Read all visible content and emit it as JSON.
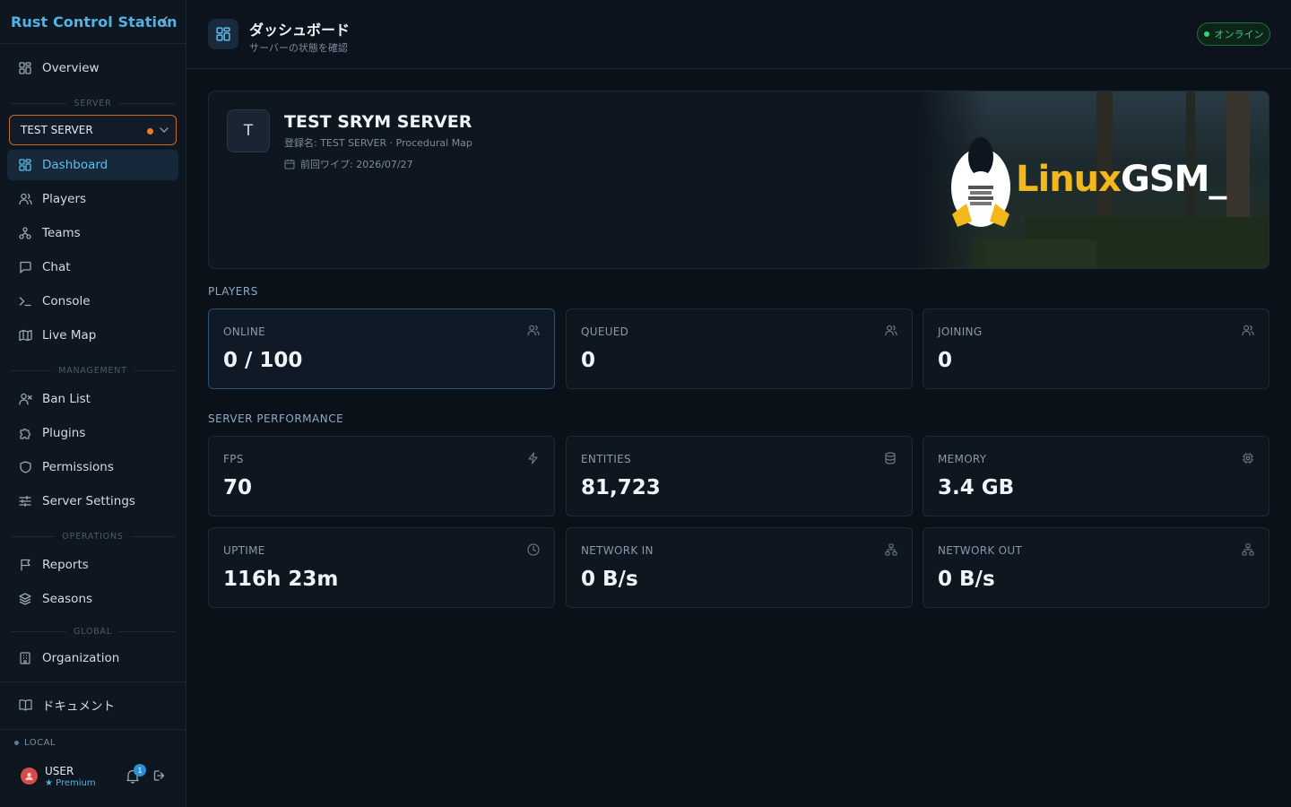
{
  "app": {
    "title": "Rust Control Station"
  },
  "sidebar": {
    "overview": "Overview",
    "sections": {
      "server": "SERVER",
      "management": "MANAGEMENT",
      "operations": "OPERATIONS",
      "global": "GLOBAL"
    },
    "server_select": {
      "value": "TEST SERVER",
      "status_color": "#f07b22"
    },
    "server_items": [
      {
        "label": "Dashboard",
        "icon": "dashboard-icon",
        "active": true
      },
      {
        "label": "Players",
        "icon": "users-icon"
      },
      {
        "label": "Teams",
        "icon": "teams-icon"
      },
      {
        "label": "Chat",
        "icon": "chat-icon"
      },
      {
        "label": "Console",
        "icon": "terminal-icon"
      },
      {
        "label": "Live Map",
        "icon": "map-icon"
      }
    ],
    "management_items": [
      {
        "label": "Ban List",
        "icon": "user-x-icon"
      },
      {
        "label": "Plugins",
        "icon": "puzzle-icon"
      },
      {
        "label": "Permissions",
        "icon": "shield-icon"
      },
      {
        "label": "Server Settings",
        "icon": "sliders-icon"
      }
    ],
    "operations_items": [
      {
        "label": "Reports",
        "icon": "flag-icon"
      },
      {
        "label": "Seasons",
        "icon": "layers-icon"
      }
    ],
    "global_items": [
      {
        "label": "Organization",
        "icon": "building-icon"
      }
    ],
    "docs": "ドキュメント",
    "env": "LOCAL",
    "user": {
      "name": "USER",
      "tier": "★ Premium",
      "notifications": "1"
    }
  },
  "header": {
    "title": "ダッシュボード",
    "subtitle": "サーバーの状態を確認",
    "status": "オンライン",
    "status_color": "#34d27a"
  },
  "server": {
    "initial": "T",
    "name": "TEST SRYM SERVER",
    "registered": "登録名: TEST SERVER · Procedural Map",
    "last_wipe": "前回ワイプ: 2026/07/27",
    "banner_left": "Linux",
    "banner_right": "GSM_"
  },
  "players": {
    "title": "PLAYERS",
    "stats": [
      {
        "label": "ONLINE",
        "value": "0 / 100",
        "icon": "users-icon"
      },
      {
        "label": "QUEUED",
        "value": "0",
        "icon": "users-icon"
      },
      {
        "label": "JOINING",
        "value": "0",
        "icon": "users-icon"
      }
    ]
  },
  "performance": {
    "title": "SERVER PERFORMANCE",
    "stats": [
      {
        "label": "FPS",
        "value": "70",
        "icon": "zap-icon"
      },
      {
        "label": "ENTITIES",
        "value": "81,723",
        "icon": "database-icon"
      },
      {
        "label": "MEMORY",
        "value": "3.4 GB",
        "icon": "cpu-icon"
      },
      {
        "label": "UPTIME",
        "value": "116h 23m",
        "icon": "clock-icon"
      },
      {
        "label": "NETWORK IN",
        "value": "0 B/s",
        "icon": "network-icon"
      },
      {
        "label": "NETWORK OUT",
        "value": "0 B/s",
        "icon": "network-icon"
      }
    ]
  }
}
